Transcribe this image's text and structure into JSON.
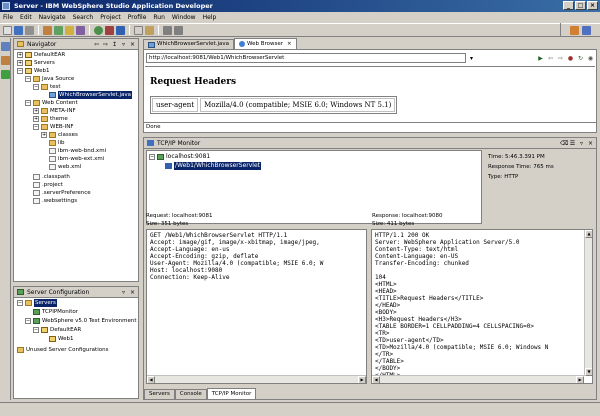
{
  "window": {
    "title": "Server - IBM WebSphere Studio Application Developer",
    "minimize": "_",
    "maximize": "□",
    "close": "×"
  },
  "menu": [
    "File",
    "Edit",
    "Navigate",
    "Search",
    "Project",
    "Profile",
    "Run",
    "Window",
    "Help"
  ],
  "navigator": {
    "title": "Navigator",
    "items": [
      {
        "label": "DefaultEAR",
        "exp": "+"
      },
      {
        "label": "Servers",
        "exp": "+"
      },
      {
        "label": "Web1",
        "exp": "−"
      },
      {
        "label": "Java Source",
        "exp": "−"
      },
      {
        "label": "test",
        "exp": "−"
      },
      {
        "label": "WhichBrowserServlet.java"
      },
      {
        "label": "Web Content",
        "exp": "−"
      },
      {
        "label": "META-INF",
        "exp": "+"
      },
      {
        "label": "theme",
        "exp": "+"
      },
      {
        "label": "WEB-INF",
        "exp": "−"
      },
      {
        "label": "classes",
        "exp": "+"
      },
      {
        "label": "lib"
      },
      {
        "label": "ibm-web-bnd.xmi"
      },
      {
        "label": "ibm-web-ext.xmi"
      },
      {
        "label": "web.xml"
      },
      {
        "label": ".classpath"
      },
      {
        "label": ".project"
      },
      {
        "label": ".serverPreference"
      },
      {
        "label": ".websettings"
      }
    ]
  },
  "serverconfig": {
    "title": "Server Configuration",
    "items": [
      {
        "label": "Servers",
        "exp": "−"
      },
      {
        "label": "TCPIPMonitor"
      },
      {
        "label": "WebSphere v5.0 Test Environment",
        "exp": "−"
      },
      {
        "label": "DefaultEAR",
        "exp": "−"
      },
      {
        "label": "Web1"
      },
      {
        "label": "Unused Server Configurations"
      }
    ]
  },
  "editor": {
    "tabs": [
      "WhichBrowserServlet.java",
      "Web Browser"
    ],
    "url": "http://localhost:9081/Web1/WhichBrowserServlet",
    "heading": "Request Headers",
    "cell_key": "user-agent",
    "cell_value": "Mozilla/4.0 (compatible; MSIE 6.0; Windows NT 5.1)",
    "status": "Done"
  },
  "monitor": {
    "title": "TCP/IP Monitor",
    "host": "localhost:9081",
    "path": "/Web1/WhichBrowserServlet",
    "time_label": "Time: 5:46.3.391 PM",
    "response_time": "Response Time: 765 ms",
    "type": "Type: HTTP",
    "request_label": "Request: localhost:9081",
    "request_size": "Size: 351 bytes",
    "response_label": "Response: localhost:9080",
    "response_size": "Size: 411 bytes",
    "request_body": "GET /Web1/WhichBrowserServlet HTTP/1.1\nAccept: image/gif, image/x-xbitmap, image/jpeg,\nAccept-Language: en-us\nAccept-Encoding: gzip, deflate\nUser-Agent: Mozilla/4.0 (compatible; MSIE 6.0; W\nHost: localhost:9080\nConnection: Keep-Alive",
    "response_body": "HTTP/1.1 200 OK\nServer: WebSphere Application Server/5.0\nContent-Type: text/html\nContent-Language: en-US\nTransfer-Encoding: chunked\n\n104\n<HTML>\n<HEAD>\n<TITLE>Request Headers</TITLE>\n</HEAD>\n<BODY>\n<H3>Request Headers</H3>\n<TABLE BORDER=1 CELLPADDING=4 CELLSPACING=0>\n<TR>\n<TD>user-agent</TD>\n<TD>Mozilla/4.0 (compatible; MSIE 6.0; Windows N\n</TR>\n</TABLE>\n</BODY>\n</HTML>"
  },
  "bottomtabs": [
    "Servers",
    "Console",
    "TCP/IP Monitor"
  ]
}
